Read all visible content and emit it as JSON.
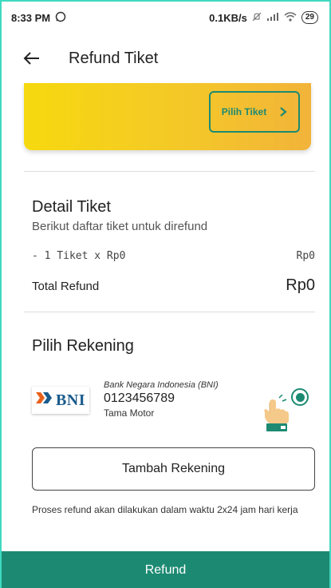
{
  "status_bar": {
    "time": "8:33 PM",
    "network_speed": "0.1KB/s",
    "battery": "29",
    "icons": [
      "whatsapp-icon",
      "mute-icon",
      "signal-icon",
      "wifi-icon",
      "battery-icon"
    ]
  },
  "app_bar": {
    "title": "Refund Tiket",
    "back_icon": "arrow-left-icon"
  },
  "banner": {
    "button_label": "Pilih Tiket",
    "button_icon": "chevron-right-icon",
    "accent": "#f6d90f"
  },
  "detail": {
    "title": "Detail Tiket",
    "subtitle": "Berikut daftar tiket untuk direfund",
    "ticket_line": "-  1 Tiket  x  Rp0",
    "ticket_amount": "Rp0",
    "total_label": "Total Refund",
    "total_value": "Rp0"
  },
  "rekening": {
    "title": "Pilih Rekening",
    "bank_name": "Bank Negara Indonesia (BNI)",
    "bank_logo_text": "BNI",
    "account_number": "0123456789",
    "account_owner": "Tama Motor",
    "selected": true
  },
  "tambah_button": "Tambah Rekening",
  "note": "Proses refund akan dilakukan dalam waktu 2x24 jam hari kerja",
  "refund_button": "Refund",
  "colors": {
    "primary": "#1c8a72",
    "frame": "#3fd9c0"
  }
}
